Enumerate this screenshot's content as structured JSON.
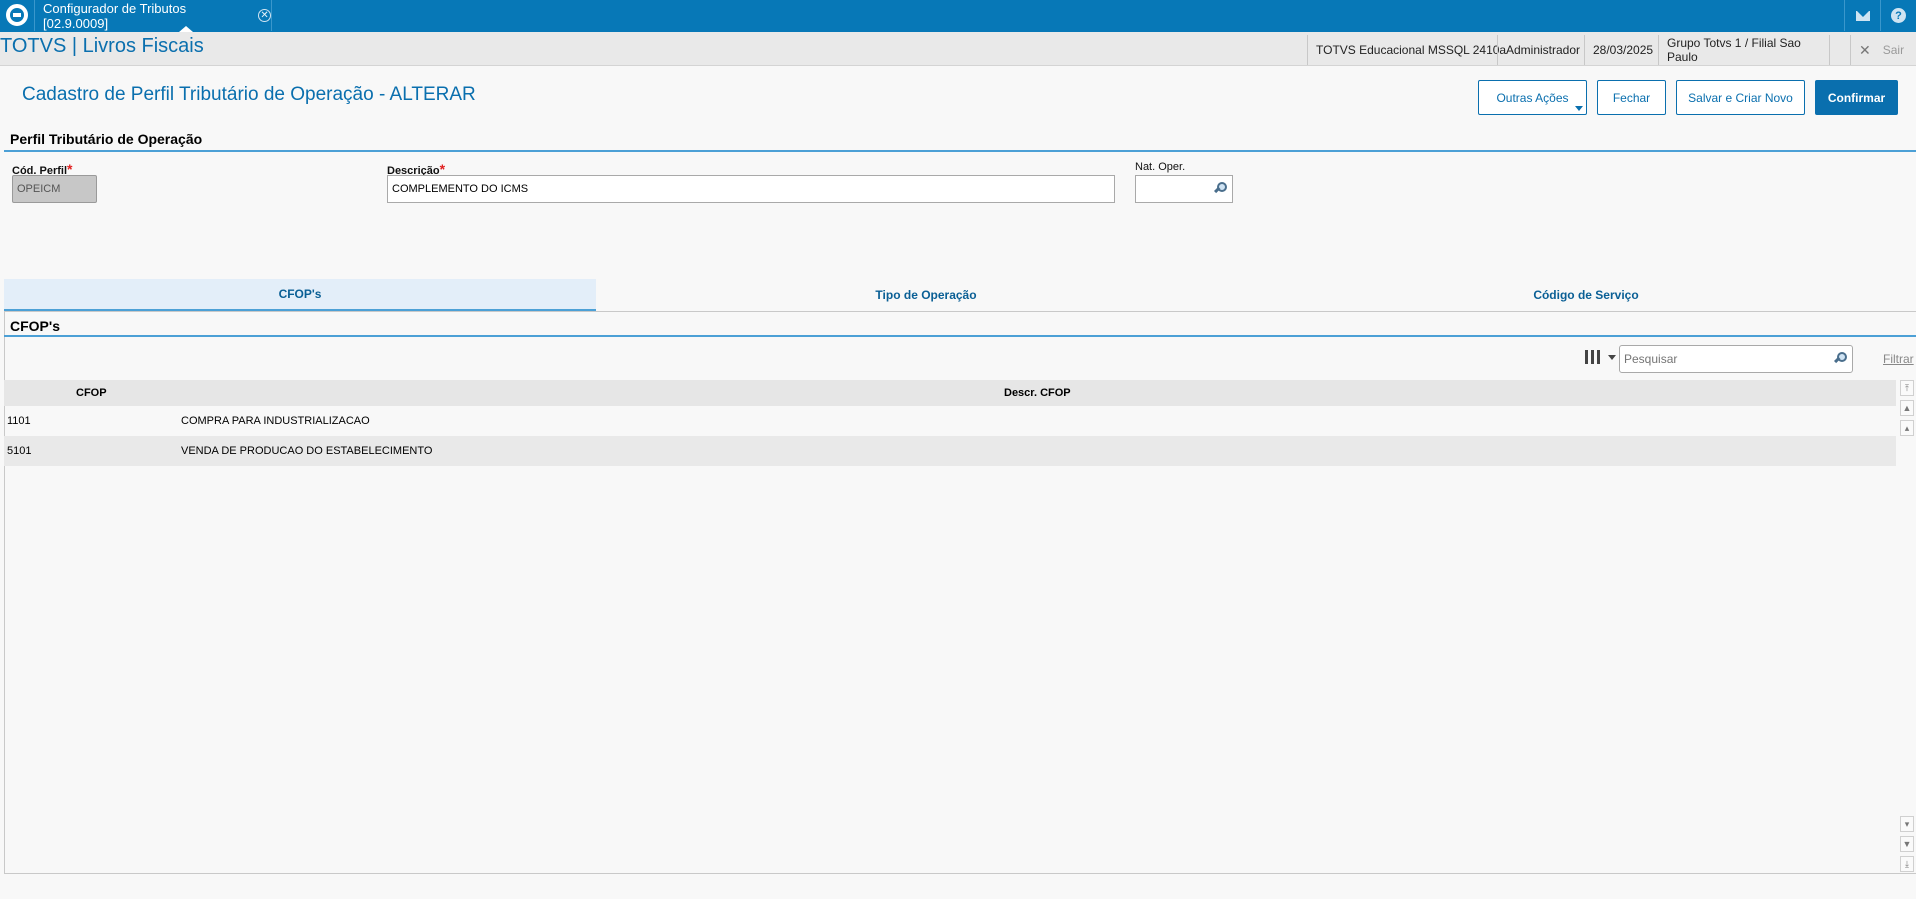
{
  "topbar": {
    "tab_title": "Configurador de Tributos [02.9.0009]",
    "close_glyph": "✕"
  },
  "header": {
    "app_title": "TOTVS | Livros Fiscais",
    "environment": "TOTVS Educacional MSSQL 2410a",
    "user": "Administrador",
    "date": "28/03/2025",
    "branch": "Grupo Totvs 1 / Filial Sao Paulo",
    "exit_label": "Sair"
  },
  "page": {
    "title": "Cadastro de Perfil Tributário de Operação - ALTERAR",
    "buttons": {
      "other_actions": "Outras Ações",
      "close": "Fechar",
      "save_new": "Salvar e Criar Novo",
      "confirm": "Confirmar"
    }
  },
  "form": {
    "section_title": "Perfil Tributário de Operação",
    "cod_perfil_label": "Cód. Perfil",
    "cod_perfil_value": "OPEICM",
    "descricao_label": "Descrição",
    "descricao_value": "COMPLEMENTO DO ICMS",
    "nat_oper_label": "Nat. Oper.",
    "nat_oper_value": "",
    "required_mark": "*"
  },
  "tabs": [
    "CFOP's",
    "Tipo de Operação",
    "Código de Serviço"
  ],
  "grid": {
    "title": "CFOP's",
    "search_placeholder": "Pesquisar",
    "filter_label": "Filtrar",
    "columns": [
      "CFOP",
      "Descr. CFOP"
    ],
    "rows": [
      {
        "cfop": "1101",
        "descr": "COMPRA PARA INDUSTRIALIZACAO"
      },
      {
        "cfop": "5101",
        "descr": "VENDA DE PRODUCAO DO ESTABELECIMENTO"
      }
    ]
  },
  "colors": {
    "brand": "#0778b7",
    "accent": "#0a6fae",
    "required": "#e02020"
  }
}
